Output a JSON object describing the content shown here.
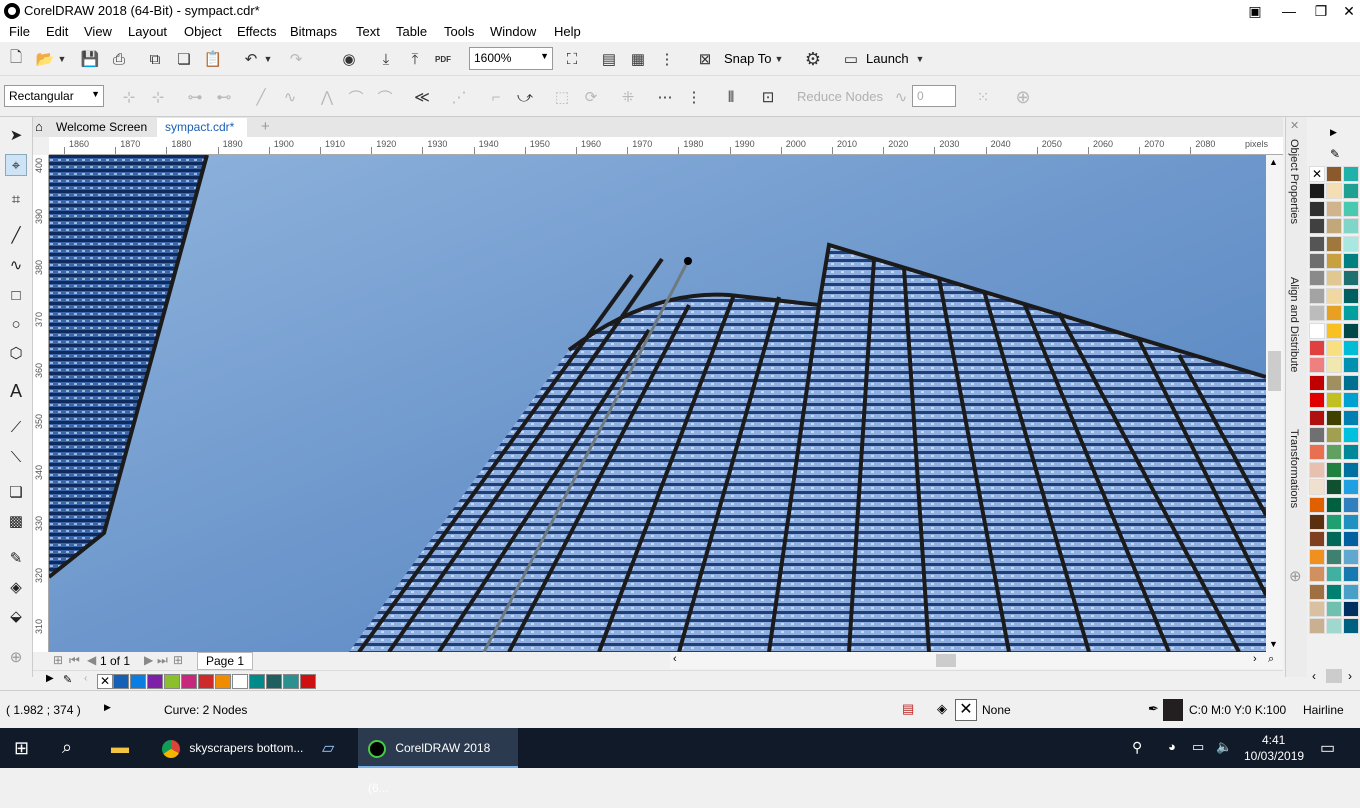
{
  "window": {
    "title": "CorelDRAW 2018 (64-Bit) - sympact.cdr*"
  },
  "menu": [
    "File",
    "Edit",
    "View",
    "Layout",
    "Object",
    "Effects",
    "Bitmaps",
    "Text",
    "Table",
    "Tools",
    "Window",
    "Help"
  ],
  "toolbar": {
    "zoom": "1600%",
    "snap_label": "Snap To",
    "launch_label": "Launch",
    "pdf_label": "PDF"
  },
  "property_bar": {
    "selection_mode": "Rectangular",
    "reduce_nodes_label": "Reduce Nodes",
    "smoothness_value": "0"
  },
  "tabs": {
    "welcome": "Welcome Screen",
    "document": "sympact.cdr*"
  },
  "ruler": {
    "units": "pixels",
    "h_ticks": [
      "1860",
      "1870",
      "1880",
      "1890",
      "1900",
      "1910",
      "1920",
      "1930",
      "1940",
      "1950",
      "1960",
      "1970",
      "1980",
      "1990",
      "2000",
      "2010",
      "2020",
      "2030",
      "2040",
      "2050",
      "2060",
      "2070",
      "2080"
    ],
    "v_ticks": [
      "400",
      "390",
      "380",
      "370",
      "360",
      "350",
      "340",
      "330",
      "320",
      "310"
    ]
  },
  "page_nav": {
    "position": "1 of 1",
    "page_tab": "Page 1"
  },
  "dockers": [
    "Object Properties",
    "Align and Distribute",
    "Transformations"
  ],
  "status": {
    "coords": "( 1.982 ; 374  )",
    "selection": "Curve: 2 Nodes",
    "fill": "None",
    "outline_color": "C:0 M:0 Y:0 K:100",
    "outline_width": "Hairline"
  },
  "taskbar": {
    "chrome": "skyscrapers bottom...",
    "corel": "CorelDRAW 2018 (6...",
    "time": "4:41",
    "date": "10/03/2019"
  },
  "doc_palette": [
    "#1560b4",
    "#0b7de0",
    "#7e1fa8",
    "#8bbf2b",
    "#c8287c",
    "#cf2a2a",
    "#f08c00",
    "#ffffff",
    "#008a8a",
    "#1f5f60",
    "#2d9090",
    "#cf1010"
  ],
  "color_palette": [
    "#000000",
    "#8b5a2b",
    "#20b2aa",
    "#1a1a1a",
    "#f5deb3",
    "#20a090",
    "#2f2f2f",
    "#d2b48c",
    "#48c9b0",
    "#404040",
    "#c2a878",
    "#7fd6c8",
    "#555555",
    "#a0783c",
    "#a8e8e0",
    "#6e6e6e",
    "#c8a040",
    "#008080",
    "#8a8a8a",
    "#e0c890",
    "#1e7070",
    "#a3a3a3",
    "#f0d8a0",
    "#006060",
    "#bcbcbc",
    "#e8a020",
    "#00a0a0",
    "#ffffff",
    "#f8c020",
    "#004848",
    "#e04040",
    "#f8e080",
    "#00bcd4",
    "#f08080",
    "#f0e8b0",
    "#0090b0",
    "#c00000",
    "#a09060",
    "#007090",
    "#e00000",
    "#c0c020",
    "#00a0d0",
    "#b01010",
    "#404000",
    "#0080b0",
    "#707070",
    "#a0a050",
    "#00c0e0",
    "#e87050",
    "#60a060",
    "#008898",
    "#e8c0b0",
    "#208040",
    "#0070a0",
    "#f0e0d0",
    "#105030",
    "#20a0e0",
    "#e06000",
    "#006040",
    "#3080c0",
    "#5a3010",
    "#20a070",
    "#2090c0",
    "#804020",
    "#006858",
    "#0060a0",
    "#f09020",
    "#408070",
    "#60a8d0",
    "#d09060",
    "#40b0a0",
    "#1878b0",
    "#a07040",
    "#008070",
    "#48a0c8",
    "#d8c0a0",
    "#70c0b0",
    "#003060",
    "#c8b090",
    "#a0d8d0",
    "#006080"
  ]
}
